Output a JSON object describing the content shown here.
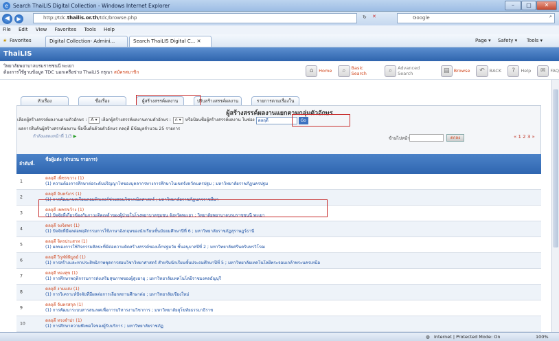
{
  "window": {
    "title": "Search ThaiLIS Digital Collection - Windows Internet Explorer",
    "controls": [
      "–",
      "□",
      "✕"
    ]
  },
  "address": {
    "url_prefix": "http://tdc.",
    "url_host": "thailis.or.th",
    "url_path": "/tdc/browse.php",
    "search_placeholder": "Google"
  },
  "menu": [
    "File",
    "Edit",
    "View",
    "Favorites",
    "Tools",
    "Help"
  ],
  "favorites": {
    "label": "Favorites",
    "tabs": [
      "Digital Collection- Admini...",
      "Search ThaiLIS Digital C... ✕"
    ],
    "tools": [
      "Page ▾",
      "Safety ▾",
      "Tools ▾"
    ]
  },
  "brand": "ThaiLIS",
  "institution": {
    "line1": "วิทยาลัยพยาบาลบรมราชชนนี พะเยา",
    "line2": "ต้องการใช้ฐานข้อมูล TDC นอกเครือข่าย ThaiLIS กรุณา",
    "register": "สมัครสมาชิก"
  },
  "topnav": [
    "Home",
    "Basic Search",
    "Advanced Search",
    "Browse",
    "BACK",
    "Help",
    "FAQ"
  ],
  "browse_tabs": [
    "หัวเรื่อง",
    "ชื่อเรื่อง",
    "ผู้สร้างสรรค์ผลงาน",
    "ปรับสร้างสรรค์ผลงาน",
    "รายการตามเรื่องใน"
  ],
  "page_title": "ผู้สร้างสรรค์ผลงานแยกตามกลุ่มตัวอักษร",
  "filter": {
    "label1": "เลือกผู้สร้างสรรค์ผลงานตามตัวอักษร :",
    "value1": "A",
    "label2": "เลือกผู้สร้างสรรค์ผลงานตามตัวอักษร :",
    "value2": "ก",
    "label3": "หรือป้อนชื่อผู้สร้างสรรค์ผลงาน ในช่อง",
    "input_value": "ดลฤดี",
    "go": "Go"
  },
  "result_text": "ผลการสืบค้นผู้สร้างสรรค์ผลงาน ชื่อขึ้นต้นด้วยตัวอักษร ดลฤดี มีข้อมูลจำนวน 25 รายการ",
  "page_info": "กำลังแสดงหน้าที่ 1/3",
  "goto_label": "ข้ามไปหน้าที่ :",
  "goto_button": "ตกลง",
  "pages": "« 1 2 3 »",
  "table": {
    "col_no": "ลำดับที่.",
    "col_name": "ชื่อผู้แต่ง (จำนวน รายการ)",
    "rows": [
      {
        "no": "1",
        "author": "ดลฤดี เพ็ชรขวาง (1)",
        "title": "(1) ความต้องการศึกษาต่อระดับปริญญาโทของบุคลากรทางการศึกษาในเขตจังหวัดนครปฐม ; มหาวิทยาลัยราชภัฏนครปฐม"
      },
      {
        "no": "2",
        "author": "ดลฤดี จันทร์เกร (1)",
        "title": "(1) การพัฒนาบทเรียนคอมพิวเตอร์ช่วยสอนวิชาคณิตศาสตร์ ; มหาวิทยาลัยราชภัฏนครราชสีมา"
      },
      {
        "no": "3",
        "author": "ดลฤดี เพชรขว้าง (1)",
        "title": "(1) ปัจจัยที่เกี่ยวข้องกับภาวะติดเหล้าของผู้ป่วยในโรงพยาบาลชุมชน จังหวัดพะเยา ; วิทยาลัยพยาบาลบรมราชชนนี พะเยา"
      },
      {
        "no": "4",
        "author": "ดลฤดี จงจิตพร (1)",
        "title": "(1) ปัจจัยที่มีผลต่อพฤติกรรมการใช้ภาษาอังกฤษของนักเรียนชั้นมัธยมศึกษาปีที่ 6 ; มหาวิทยาลัยราชภัฏสุราษฎร์ธานี"
      },
      {
        "no": "5",
        "author": "ดลฤดี จิตรประสาท (1)",
        "title": "(1) ผลของการใช้กิจกรรมศิลปะที่มีต่อความคิดสร้างสรรค์ของเด็กปฐมวัย ชั้นอนุบาลปีที่ 2 ; มหาวิทยาลัยศรีนครินทรวิโรฒ"
      },
      {
        "no": "6",
        "author": "ดลฤดี วิรุฬห์พิบูลย์ (1)",
        "title": "(1) การสร้างและหาประสิทธิภาพชุดการสอนวิชาวิทยาศาสตร์ สำหรับนักเรียนชั้นประถมศึกษาปีที่ 5 ; มหาวิทยาลัยเทคโนโลยีพระจอมเกล้าพระนครเหนือ"
      },
      {
        "no": "7",
        "author": "ดลฤดี ทองสุข (1)",
        "title": "(1) การศึกษาพฤติกรรมการส่งเสริมสุขภาพของผู้สูงอายุ ; มหาวิทยาลัยเทคโนโลยีราชมงคลธัญบุรี"
      },
      {
        "no": "8",
        "author": "ดลฤดี งามแสง (1)",
        "title": "(1) การวิเคราะห์ปัจจัยที่มีผลต่อการเลือกสถานศึกษาต่อ ; มหาวิทยาลัยเชียงใหม่"
      },
      {
        "no": "9",
        "author": "ดลฤดี จันทรสกุล (1)",
        "title": "(1) การพัฒนาระบบสารสนเทศเพื่อการบริหารงานวิชาการ ; มหาวิทยาลัยสุโขทัยธรรมาธิราช"
      },
      {
        "no": "10",
        "author": "ดลฤดี ทรงจำปา (1)",
        "title": "(1) การศึกษาความพึงพอใจของผู้รับบริการ ; มหาวิทยาลัยราชภัฏ"
      }
    ]
  },
  "status": {
    "zone": "Internet | Protected Mode: On",
    "zoom": "100%"
  }
}
